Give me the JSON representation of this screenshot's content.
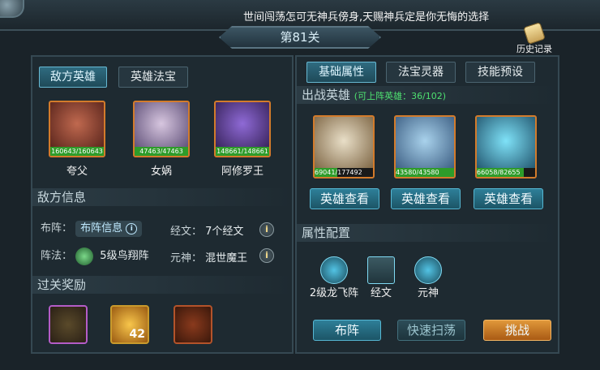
{
  "marquee_text": "世间闯荡怎可无神兵傍身,天赐神兵定是你无悔的选择",
  "stage_title": "第81关",
  "history_label": "历史记录",
  "left_tabs": [
    "敌方英雄",
    "英雄法宝"
  ],
  "enemy_heroes": [
    {
      "name": "夸父",
      "hp_text": "160643/160643",
      "hp_fraction": 1.0
    },
    {
      "name": "女娲",
      "hp_text": "47463/47463",
      "hp_fraction": 1.0
    },
    {
      "name": "阿修罗王",
      "hp_text": "148661/148661",
      "hp_fraction": 1.0
    }
  ],
  "enemy_info": {
    "title": "敌方信息",
    "formation_label": "布阵：",
    "formation_button": "布阵信息",
    "scripture_label": "经文：",
    "scripture_value": "7个经文",
    "method_label": "阵法：",
    "method_value": "5级鸟翔阵",
    "god_label": "元神：",
    "god_value": "混世魔王"
  },
  "rewards": {
    "title": "过关奖励",
    "gold_count": "42"
  },
  "right_tabs": [
    "基础属性",
    "法宝灵器",
    "技能预设"
  ],
  "battle_heroes": {
    "title": "出战英雄",
    "capacity_text": "(可上阵英雄：36/102)",
    "heroes": [
      {
        "hp_text": "69041/177492",
        "hp_fraction": 0.389
      },
      {
        "hp_text": "43580/43580",
        "hp_fraction": 1.0
      },
      {
        "hp_text": "66058/82655",
        "hp_fraction": 0.799
      }
    ],
    "view_button": "英雄查看"
  },
  "attributes": {
    "title": "属性配置",
    "items": [
      "2级龙飞阵",
      "经文",
      "元神"
    ]
  },
  "actions": {
    "deploy": "布阵",
    "sweep": "快速扫荡",
    "challenge": "挑战"
  },
  "colors": {
    "accent_teal": "#2e7f98",
    "accent_orange": "#e0983a",
    "hp_green": "#2e9c2a"
  }
}
